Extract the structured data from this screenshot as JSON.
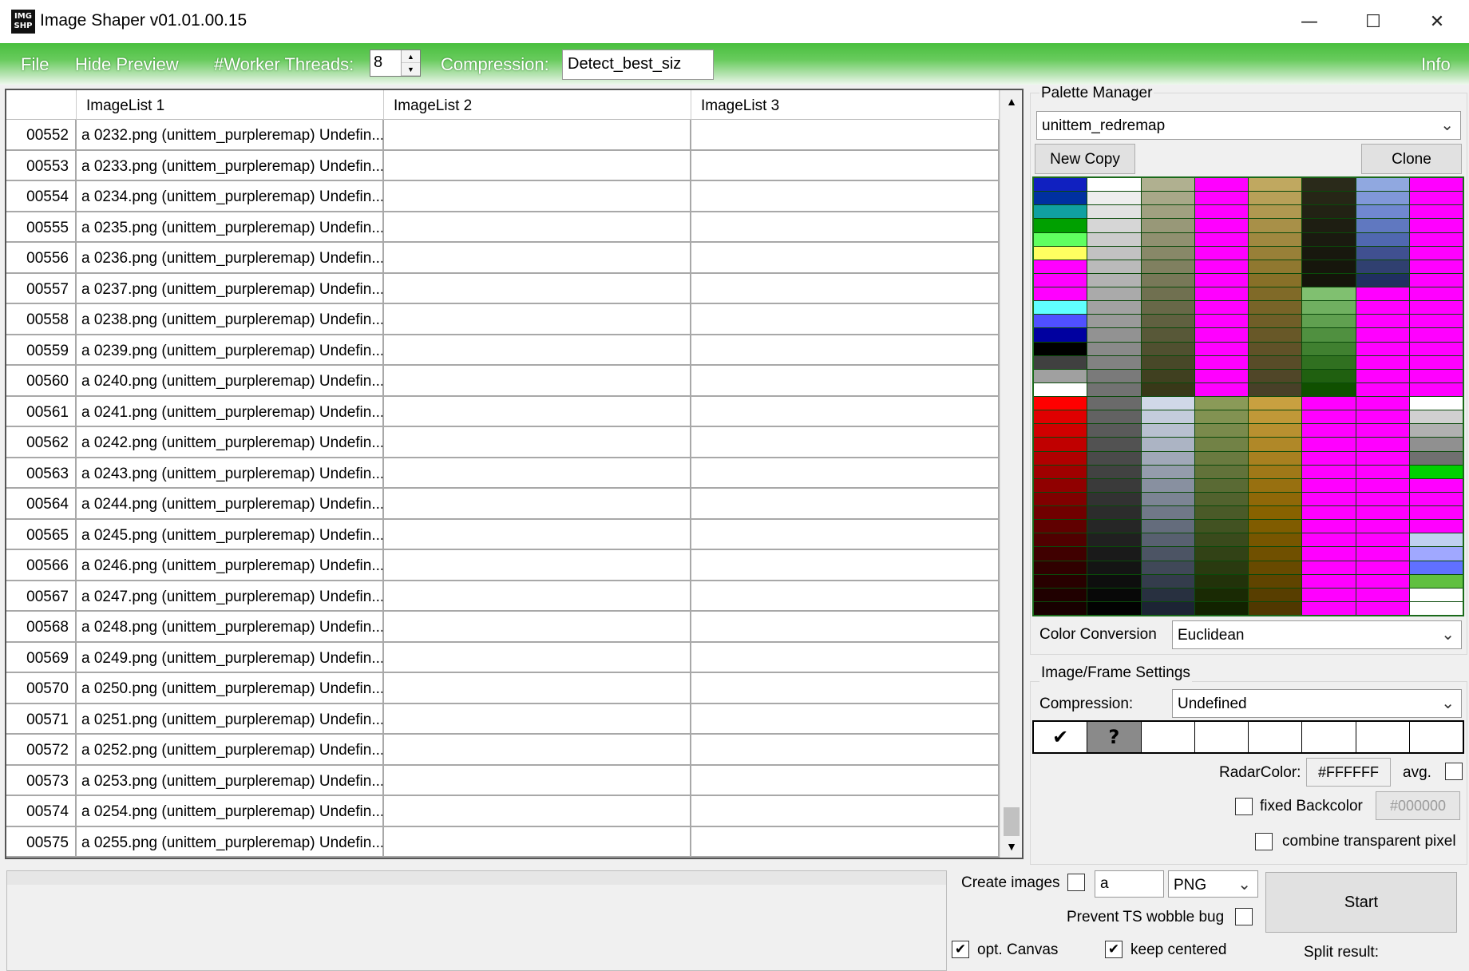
{
  "window": {
    "icon_text": "IMG SHP",
    "title": "Image Shaper v01.01.00.15",
    "min_glyph": "—",
    "max_glyph": "☐",
    "close_glyph": "✕"
  },
  "menubar": {
    "file": "File",
    "hide_preview": "Hide Preview",
    "worker_threads_label": "#Worker Threads:",
    "worker_threads_value": "8",
    "compression_label": "Compression:",
    "compression_value": "Detect_best_siz",
    "info": "Info"
  },
  "table": {
    "columns": [
      "",
      "ImageList 1",
      "ImageList 2",
      "ImageList 3"
    ],
    "rows": [
      {
        "idx": "00552",
        "c1": "a 0232.png (unittem_purpleremap) Undefin...",
        "c2": "",
        "c3": ""
      },
      {
        "idx": "00553",
        "c1": "a 0233.png (unittem_purpleremap) Undefin...",
        "c2": "",
        "c3": ""
      },
      {
        "idx": "00554",
        "c1": "a 0234.png (unittem_purpleremap) Undefin...",
        "c2": "",
        "c3": ""
      },
      {
        "idx": "00555",
        "c1": "a 0235.png (unittem_purpleremap) Undefin...",
        "c2": "",
        "c3": ""
      },
      {
        "idx": "00556",
        "c1": "a 0236.png (unittem_purpleremap) Undefin...",
        "c2": "",
        "c3": ""
      },
      {
        "idx": "00557",
        "c1": "a 0237.png (unittem_purpleremap) Undefin...",
        "c2": "",
        "c3": ""
      },
      {
        "idx": "00558",
        "c1": "a 0238.png (unittem_purpleremap) Undefin...",
        "c2": "",
        "c3": ""
      },
      {
        "idx": "00559",
        "c1": "a 0239.png (unittem_purpleremap) Undefin...",
        "c2": "",
        "c3": ""
      },
      {
        "idx": "00560",
        "c1": "a 0240.png (unittem_purpleremap) Undefin...",
        "c2": "",
        "c3": ""
      },
      {
        "idx": "00561",
        "c1": "a 0241.png (unittem_purpleremap) Undefin...",
        "c2": "",
        "c3": ""
      },
      {
        "idx": "00562",
        "c1": "a 0242.png (unittem_purpleremap) Undefin...",
        "c2": "",
        "c3": ""
      },
      {
        "idx": "00563",
        "c1": "a 0243.png (unittem_purpleremap) Undefin...",
        "c2": "",
        "c3": ""
      },
      {
        "idx": "00564",
        "c1": "a 0244.png (unittem_purpleremap) Undefin...",
        "c2": "",
        "c3": ""
      },
      {
        "idx": "00565",
        "c1": "a 0245.png (unittem_purpleremap) Undefin...",
        "c2": "",
        "c3": ""
      },
      {
        "idx": "00566",
        "c1": "a 0246.png (unittem_purpleremap) Undefin...",
        "c2": "",
        "c3": ""
      },
      {
        "idx": "00567",
        "c1": "a 0247.png (unittem_purpleremap) Undefin...",
        "c2": "",
        "c3": ""
      },
      {
        "idx": "00568",
        "c1": "a 0248.png (unittem_purpleremap) Undefin...",
        "c2": "",
        "c3": ""
      },
      {
        "idx": "00569",
        "c1": "a 0249.png (unittem_purpleremap) Undefin...",
        "c2": "",
        "c3": ""
      },
      {
        "idx": "00570",
        "c1": "a 0250.png (unittem_purpleremap) Undefin...",
        "c2": "",
        "c3": ""
      },
      {
        "idx": "00571",
        "c1": "a 0251.png (unittem_purpleremap) Undefin...",
        "c2": "",
        "c3": ""
      },
      {
        "idx": "00572",
        "c1": "a 0252.png (unittem_purpleremap) Undefin...",
        "c2": "",
        "c3": ""
      },
      {
        "idx": "00573",
        "c1": "a 0253.png (unittem_purpleremap) Undefin...",
        "c2": "",
        "c3": ""
      },
      {
        "idx": "00574",
        "c1": "a 0254.png (unittem_purpleremap) Undefin...",
        "c2": "",
        "c3": ""
      },
      {
        "idx": "00575",
        "c1": "a 0255.png (unittem_purpleremap) Undefin...",
        "c2": "",
        "c3": ""
      }
    ]
  },
  "palette_manager": {
    "label": "Palette Manager",
    "selected_palette": "unittem_redremap",
    "new_copy": "New Copy",
    "clone": "Clone",
    "colors": [
      "#1020c0",
      "#0030a0",
      "#10a0a0",
      "#00a000",
      "#60ff60",
      "#ffff60",
      "#ff00ff",
      "#ff00ff",
      "#ff00ff",
      "#60ffff",
      "#5050ff",
      "#0000a0",
      "#000000",
      "#404040",
      "#a0a0a0",
      "#ffffff",
      "#ff0000",
      "#e00000",
      "#d00000",
      "#c00000",
      "#b00000",
      "#a00000",
      "#900000",
      "#800000",
      "#700000",
      "#600000",
      "#500000",
      "#400000",
      "#300000",
      "#280000",
      "#200000",
      "#180000",
      "#ffffff",
      "#eeeeee",
      "#e2e2e2",
      "#d6d6d6",
      "#cccccc",
      "#c2c2c2",
      "#bababa",
      "#b2b2b2",
      "#aaaaaa",
      "#a2a2a2",
      "#9a9a9a",
      "#929292",
      "#8a8a8a",
      "#828282",
      "#7a7a7a",
      "#727272",
      "#6a6a6a",
      "#626262",
      "#5a5a5a",
      "#525252",
      "#4a4a4a",
      "#424242",
      "#3a3a3a",
      "#323232",
      "#2c2c2c",
      "#262626",
      "#202020",
      "#1a1a1a",
      "#141414",
      "#0e0e0e",
      "#080808",
      "#020202",
      "#b0b090",
      "#a8a888",
      "#a0a080",
      "#989878",
      "#909070",
      "#888868",
      "#808060",
      "#787858",
      "#707050",
      "#686848",
      "#606040",
      "#585838",
      "#505030",
      "#484828",
      "#404020",
      "#383818",
      "#d0d8e8",
      "#c4ccdc",
      "#b8c0d0",
      "#acb4c4",
      "#a0a8b8",
      "#949cac",
      "#8890a0",
      "#7c8494",
      "#707888",
      "#646c7c",
      "#586070",
      "#4c5464",
      "#404858",
      "#343c4c",
      "#283040",
      "#1c2434",
      "#ff00ff",
      "#ff00ff",
      "#ff00ff",
      "#ff00ff",
      "#ff00ff",
      "#ff00ff",
      "#ff00ff",
      "#ff00ff",
      "#ff00ff",
      "#ff00ff",
      "#ff00ff",
      "#ff00ff",
      "#ff00ff",
      "#ff00ff",
      "#ff00ff",
      "#ff00ff",
      "#8a9a58",
      "#829252",
      "#7a8a4c",
      "#728246",
      "#6a7a40",
      "#62723a",
      "#5a6a34",
      "#52622e",
      "#4a5a28",
      "#425222",
      "#3a4a1c",
      "#324216",
      "#2a3a10",
      "#22320a",
      "#1a2a04",
      "#122200",
      "#c0a860",
      "#b8a058",
      "#b09850",
      "#a89048",
      "#a08840",
      "#988038",
      "#907830",
      "#887028",
      "#806a28",
      "#786428",
      "#705e28",
      "#685828",
      "#605228",
      "#584c28",
      "#504628",
      "#484028",
      "#c8a040",
      "#c09838",
      "#b89030",
      "#b08828",
      "#a88020",
      "#a07818",
      "#987010",
      "#906808",
      "#886200",
      "#805c00",
      "#785600",
      "#705000",
      "#684a00",
      "#604400",
      "#583e00",
      "#503800",
      "#2a2a1a",
      "#262616",
      "#222214",
      "#1e1e12",
      "#1a1a10",
      "#18180e",
      "#16160c",
      "#14140a",
      "#80c070",
      "#70b060",
      "#60a050",
      "#509040",
      "#408030",
      "#307020",
      "#206010",
      "#105000",
      "#ff00ff",
      "#ff00ff",
      "#ff00ff",
      "#ff00ff",
      "#ff00ff",
      "#ff00ff",
      "#ff00ff",
      "#ff00ff",
      "#ff00ff",
      "#ff00ff",
      "#ff00ff",
      "#ff00ff",
      "#ff00ff",
      "#ff00ff",
      "#ff00ff",
      "#ff00ff",
      "#90a8e0",
      "#8098d8",
      "#7088d0",
      "#6078c0",
      "#5068b0",
      "#405090",
      "#304070",
      "#203060",
      "#ff00ff",
      "#ff00ff",
      "#ff00ff",
      "#ff00ff",
      "#ff00ff",
      "#ff00ff",
      "#ff00ff",
      "#ff00ff",
      "#ff00ff",
      "#ff00ff",
      "#ff00ff",
      "#ff00ff",
      "#ff00ff",
      "#ff00ff",
      "#ff00ff",
      "#ff00ff",
      "#ff00ff",
      "#ff00ff",
      "#ff00ff",
      "#ff00ff",
      "#ff00ff",
      "#ff00ff",
      "#ff00ff",
      "#ff00ff",
      "#ff00ff",
      "#ff00ff",
      "#ff00ff",
      "#ff00ff",
      "#ff00ff",
      "#ff00ff",
      "#ff00ff",
      "#ff00ff",
      "#ff00ff",
      "#ff00ff",
      "#ff00ff",
      "#ff00ff",
      "#ff00ff",
      "#ff00ff",
      "#ff00ff",
      "#ff00ff",
      "#ffffff",
      "#d0d0d0",
      "#b0b0b0",
      "#909090",
      "#707070",
      "#00d000",
      "#ff00ff",
      "#ff00ff",
      "#ff00ff",
      "#ff00ff",
      "#c0d0f0",
      "#a0a8ff",
      "#6070ff",
      "#60c040",
      "#ffffff",
      "#ffffff"
    ],
    "color_conversion_label": "Color Conversion",
    "color_conversion_value": "Euclidean"
  },
  "frame_settings": {
    "label": "Image/Frame Settings",
    "compression_label": "Compression:",
    "compression_value": "Undefined",
    "strip": [
      "✔",
      "?",
      "",
      "",
      "",
      "",
      "",
      ""
    ],
    "radar_label": "RadarColor:",
    "radar_value": "#FFFFFF",
    "avg_label": "avg.",
    "fixed_backcolor_label": "fixed Backcolor",
    "fixed_backcolor_value": "#000000",
    "combine_label": "combine transparent pixel"
  },
  "bottom": {
    "create_images_label": "Create images",
    "prefix_value": "a",
    "format_value": "PNG",
    "prevent_wobble_label": "Prevent TS wobble bug",
    "start": "Start",
    "opt_canvas_label": "opt. Canvas",
    "keep_centered_label": "keep centered",
    "split_result_label": "Split result:",
    "check_glyph": "✔"
  }
}
